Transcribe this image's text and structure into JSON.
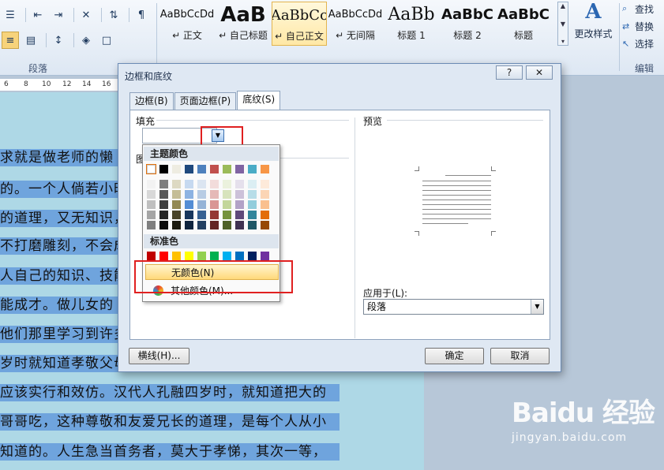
{
  "ribbon": {
    "paragraph_group_label": "段落",
    "edit_group_label": "编辑",
    "styles": [
      {
        "sample": "AaBbCcDd",
        "name": "↵ 正文"
      },
      {
        "sample": "AaB",
        "name": "↵ 自己标题"
      },
      {
        "sample": "AaBbCc",
        "name": "↵ 自己正文"
      },
      {
        "sample": "AaBbCcDd",
        "name": "↵ 无间隔"
      },
      {
        "sample": "AaBb",
        "name": "标题 1"
      },
      {
        "sample": "AaBbC",
        "name": "标题 2"
      },
      {
        "sample": "AaBbC",
        "name": "标题"
      }
    ],
    "change_styles_label": "更改样式",
    "find_label": "查找",
    "replace_label": "替换",
    "select_label": "选择"
  },
  "ruler": {
    "ticks": [
      "6",
      "8",
      "10",
      "12",
      "14",
      "16"
    ]
  },
  "document": {
    "lines": [
      "求就是做老师的懒",
      "的。一个人倘若小时",
      "的道理，又无知识，",
      "不打磨雕刻，不会成",
      "人自己的知识、技能",
      "能成才。做儿女的",
      "他们那里学习到许多",
      "岁时就知道孝敬父母",
      "应该实行和效仿。汉代人孔融四岁时，就知道把大的",
      "哥哥吃，这种尊敬和友爱兄长的道理，是每个人从小",
      "知道的。人生急当首务者，莫大于孝悌，其次一等，"
    ]
  },
  "dialog": {
    "title": "边框和底纹",
    "help_label": "?",
    "close_label": "✕",
    "tabs": [
      "边框(B)",
      "页面边框(P)",
      "底纹(S)"
    ],
    "fill_label": "填充",
    "pattern_label": "图",
    "preview_label": "预览",
    "apply_to_label": "应用于(L):",
    "apply_to_value": "段落",
    "horizontal_line_button": "横线(H)...",
    "ok_button": "确定",
    "cancel_button": "取消"
  },
  "color_dropdown": {
    "theme_colors_header": "主题颜色",
    "standard_colors_header": "标准色",
    "no_color_label": "无颜色(N)",
    "more_colors_label": "其他颜色(M)...",
    "theme_top_row": [
      "#ffffff",
      "#000000",
      "#eeece1",
      "#1f497d",
      "#4f81bd",
      "#c0504d",
      "#9bbb59",
      "#8064a2",
      "#4bacc6",
      "#f79646"
    ],
    "theme_shade_rows": [
      [
        "#f2f2f2",
        "#7f7f7f",
        "#ddd9c3",
        "#c6d9f0",
        "#dbe5f1",
        "#f2dcdb",
        "#ebf1dd",
        "#e5e0ec",
        "#dbeef3",
        "#fdeada"
      ],
      [
        "#d8d8d8",
        "#595959",
        "#c4bd97",
        "#8db3e2",
        "#b8cce4",
        "#e5b9b7",
        "#d7e3bc",
        "#ccc1d9",
        "#b7dde8",
        "#fbd5b5"
      ],
      [
        "#bfbfbf",
        "#3f3f3f",
        "#938953",
        "#548dd4",
        "#95b3d7",
        "#d99694",
        "#c3d69b",
        "#b2a2c7",
        "#92cddc",
        "#fac08f"
      ],
      [
        "#a5a5a5",
        "#262626",
        "#494429",
        "#17365d",
        "#366092",
        "#953734",
        "#76923c",
        "#5f497a",
        "#31859b",
        "#e36c09"
      ],
      [
        "#7f7f7f",
        "#0c0c0c",
        "#1d1b10",
        "#0f243e",
        "#244061",
        "#632423",
        "#4f6128",
        "#3f3151",
        "#205867",
        "#974806"
      ]
    ],
    "standard_row": [
      "#c00000",
      "#ff0000",
      "#ffc000",
      "#ffff00",
      "#92d050",
      "#00b050",
      "#00b0f0",
      "#0070c0",
      "#002060",
      "#7030a0"
    ]
  },
  "watermark": {
    "main": "Baidu 经验",
    "sub": "jingyan.baidu.com"
  }
}
